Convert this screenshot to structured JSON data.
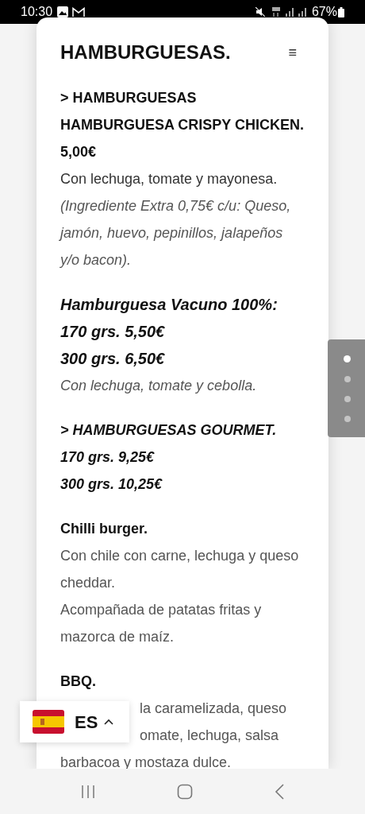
{
  "status_bar": {
    "time": "10:30",
    "battery": "67%"
  },
  "page": {
    "title": "HAMBURGUESAS.",
    "menu_icon": "≡"
  },
  "sections": [
    {
      "lines": [
        {
          "kind": "bold",
          "text": "> HAMBURGUESAS"
        },
        {
          "kind": "bold",
          "text": "HAMBURGUESA CRISPY CHICKEN."
        },
        {
          "kind": "bold",
          "text": "5,00€"
        },
        {
          "kind": "body",
          "text": "Con lechuga, tomate y mayonesa."
        },
        {
          "kind": "note",
          "text": "(Ingrediente Extra 0,75€ c/u: Queso, jamón, huevo, pepinillos, jalapeños y/o bacon)."
        }
      ]
    },
    {
      "lines": [
        {
          "kind": "bold_italic_large",
          "text": "Hamburguesa Vacuno 100%:"
        },
        {
          "kind": "bold_italic_large",
          "text": "170 grs. 5,50€"
        },
        {
          "kind": "bold_italic_large",
          "text": "300 grs. 6,50€"
        },
        {
          "kind": "note",
          "text": "Con lechuga, tomate y cebolla."
        }
      ]
    },
    {
      "lines": [
        {
          "kind": "bold_italic",
          "text": "> HAMBURGUESAS GOURMET."
        },
        {
          "kind": "bold_italic",
          "text": "170 grs. 9,25€"
        },
        {
          "kind": "bold_italic",
          "text": "300 grs. 10,25€"
        }
      ]
    },
    {
      "lines": [
        {
          "kind": "bold",
          "text": "Chilli burger."
        },
        {
          "kind": "grey",
          "text": "Con chile con carne, lechuga y queso cheddar."
        },
        {
          "kind": "grey",
          "text": "Acompañada de patatas fritas y mazorca de maíz."
        }
      ]
    },
    {
      "lines": [
        {
          "kind": "bold",
          "text": "BBQ."
        },
        {
          "kind": "covered",
          "text": "la caramelizada, queso"
        },
        {
          "kind": "covered",
          "text": "omate, lechuga, salsa"
        },
        {
          "kind": "grey",
          "text": "barbacoa y mostaza dulce."
        }
      ]
    }
  ],
  "slide_dots": [
    {
      "selected": true
    },
    {
      "selected": false
    },
    {
      "selected": false
    },
    {
      "selected": false
    }
  ],
  "language": {
    "code": "ES"
  }
}
